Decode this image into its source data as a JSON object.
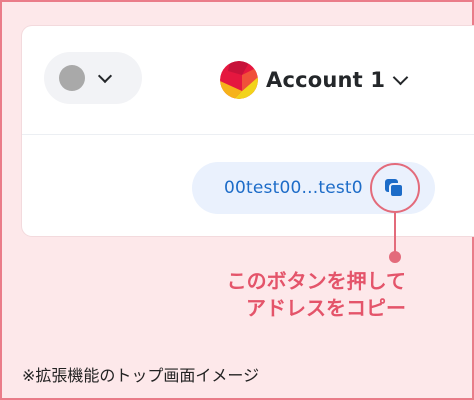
{
  "header": {
    "network": {
      "chevron_icon": "chevron-down-icon"
    },
    "account": {
      "name": "Account 1",
      "avatar_icon": "account-avatar-icon",
      "chevron_icon": "chevron-down-icon"
    }
  },
  "address": {
    "text": "00test00...test0",
    "copy_icon": "copy-icon"
  },
  "annotation": {
    "line1": "このボタンを押して",
    "line2": "アドレスをコピー"
  },
  "footnote": "※拡張機能のトップ画面イメージ",
  "colors": {
    "frame_border": "#ea7c89",
    "background": "#fde8ea",
    "accent_blue": "#1d6cc8",
    "address_pill": "#eaf1fd",
    "annotation": "#e4546a"
  }
}
